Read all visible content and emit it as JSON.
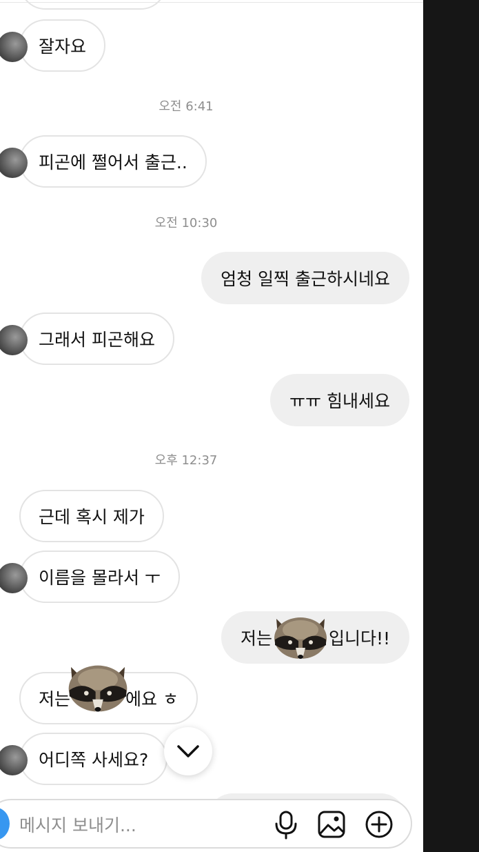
{
  "messages": {
    "m1": "잘자요",
    "ts1": "오전 6:41",
    "m2": "피곤에 쩔어서 출근..",
    "ts2": "오전 10:30",
    "m3": "엄청 일찍 출근하시네요",
    "m4": "그래서 피곤해요",
    "m5": "ㅠㅠ 힘내세요",
    "ts3": "오후 12:37",
    "m6": "근데 혹시 제가",
    "m7": "이름을 몰라서 ㅜ",
    "m8_pre": "저는",
    "m8_post": "입니다!!",
    "m9_pre": "저는",
    "m9_post": "에요 ㅎ",
    "m10": "어디쪽 사세요?"
  },
  "composer": {
    "placeholder": "메시지 보내기..."
  },
  "icons": {
    "scroll": "chevron-down-icon",
    "mic": "microphone-icon",
    "gallery": "image-icon",
    "add": "plus-circle-icon",
    "sticker": "raccoon-sticker"
  },
  "colors": {
    "outgoing_bubble": "#efefef",
    "incoming_border": "#e3e3e3",
    "accent": "#3797f0",
    "background_right": "#161616"
  }
}
